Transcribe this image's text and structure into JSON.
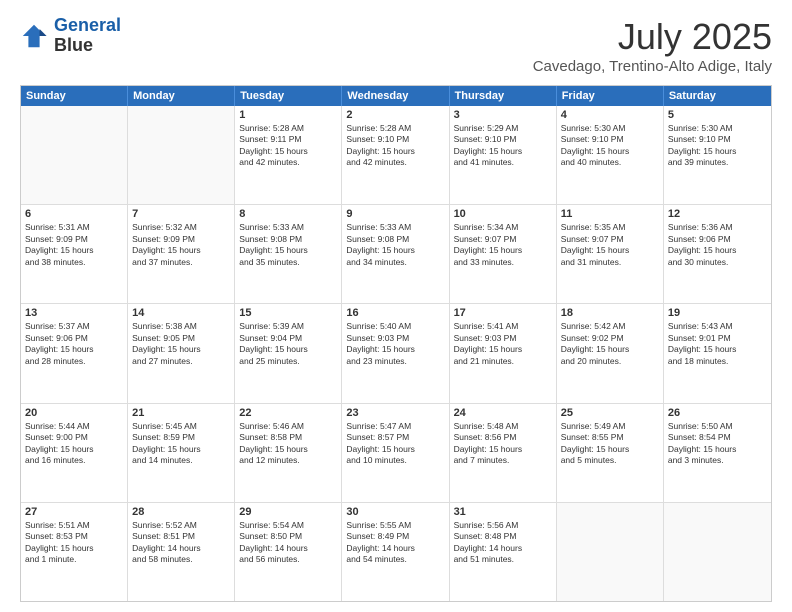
{
  "header": {
    "logo_line1": "General",
    "logo_line2": "Blue",
    "month": "July 2025",
    "location": "Cavedago, Trentino-Alto Adige, Italy"
  },
  "weekdays": [
    "Sunday",
    "Monday",
    "Tuesday",
    "Wednesday",
    "Thursday",
    "Friday",
    "Saturday"
  ],
  "rows": [
    [
      {
        "day": "",
        "lines": []
      },
      {
        "day": "",
        "lines": []
      },
      {
        "day": "1",
        "lines": [
          "Sunrise: 5:28 AM",
          "Sunset: 9:11 PM",
          "Daylight: 15 hours",
          "and 42 minutes."
        ]
      },
      {
        "day": "2",
        "lines": [
          "Sunrise: 5:28 AM",
          "Sunset: 9:10 PM",
          "Daylight: 15 hours",
          "and 42 minutes."
        ]
      },
      {
        "day": "3",
        "lines": [
          "Sunrise: 5:29 AM",
          "Sunset: 9:10 PM",
          "Daylight: 15 hours",
          "and 41 minutes."
        ]
      },
      {
        "day": "4",
        "lines": [
          "Sunrise: 5:30 AM",
          "Sunset: 9:10 PM",
          "Daylight: 15 hours",
          "and 40 minutes."
        ]
      },
      {
        "day": "5",
        "lines": [
          "Sunrise: 5:30 AM",
          "Sunset: 9:10 PM",
          "Daylight: 15 hours",
          "and 39 minutes."
        ]
      }
    ],
    [
      {
        "day": "6",
        "lines": [
          "Sunrise: 5:31 AM",
          "Sunset: 9:09 PM",
          "Daylight: 15 hours",
          "and 38 minutes."
        ]
      },
      {
        "day": "7",
        "lines": [
          "Sunrise: 5:32 AM",
          "Sunset: 9:09 PM",
          "Daylight: 15 hours",
          "and 37 minutes."
        ]
      },
      {
        "day": "8",
        "lines": [
          "Sunrise: 5:33 AM",
          "Sunset: 9:08 PM",
          "Daylight: 15 hours",
          "and 35 minutes."
        ]
      },
      {
        "day": "9",
        "lines": [
          "Sunrise: 5:33 AM",
          "Sunset: 9:08 PM",
          "Daylight: 15 hours",
          "and 34 minutes."
        ]
      },
      {
        "day": "10",
        "lines": [
          "Sunrise: 5:34 AM",
          "Sunset: 9:07 PM",
          "Daylight: 15 hours",
          "and 33 minutes."
        ]
      },
      {
        "day": "11",
        "lines": [
          "Sunrise: 5:35 AM",
          "Sunset: 9:07 PM",
          "Daylight: 15 hours",
          "and 31 minutes."
        ]
      },
      {
        "day": "12",
        "lines": [
          "Sunrise: 5:36 AM",
          "Sunset: 9:06 PM",
          "Daylight: 15 hours",
          "and 30 minutes."
        ]
      }
    ],
    [
      {
        "day": "13",
        "lines": [
          "Sunrise: 5:37 AM",
          "Sunset: 9:06 PM",
          "Daylight: 15 hours",
          "and 28 minutes."
        ]
      },
      {
        "day": "14",
        "lines": [
          "Sunrise: 5:38 AM",
          "Sunset: 9:05 PM",
          "Daylight: 15 hours",
          "and 27 minutes."
        ]
      },
      {
        "day": "15",
        "lines": [
          "Sunrise: 5:39 AM",
          "Sunset: 9:04 PM",
          "Daylight: 15 hours",
          "and 25 minutes."
        ]
      },
      {
        "day": "16",
        "lines": [
          "Sunrise: 5:40 AM",
          "Sunset: 9:03 PM",
          "Daylight: 15 hours",
          "and 23 minutes."
        ]
      },
      {
        "day": "17",
        "lines": [
          "Sunrise: 5:41 AM",
          "Sunset: 9:03 PM",
          "Daylight: 15 hours",
          "and 21 minutes."
        ]
      },
      {
        "day": "18",
        "lines": [
          "Sunrise: 5:42 AM",
          "Sunset: 9:02 PM",
          "Daylight: 15 hours",
          "and 20 minutes."
        ]
      },
      {
        "day": "19",
        "lines": [
          "Sunrise: 5:43 AM",
          "Sunset: 9:01 PM",
          "Daylight: 15 hours",
          "and 18 minutes."
        ]
      }
    ],
    [
      {
        "day": "20",
        "lines": [
          "Sunrise: 5:44 AM",
          "Sunset: 9:00 PM",
          "Daylight: 15 hours",
          "and 16 minutes."
        ]
      },
      {
        "day": "21",
        "lines": [
          "Sunrise: 5:45 AM",
          "Sunset: 8:59 PM",
          "Daylight: 15 hours",
          "and 14 minutes."
        ]
      },
      {
        "day": "22",
        "lines": [
          "Sunrise: 5:46 AM",
          "Sunset: 8:58 PM",
          "Daylight: 15 hours",
          "and 12 minutes."
        ]
      },
      {
        "day": "23",
        "lines": [
          "Sunrise: 5:47 AM",
          "Sunset: 8:57 PM",
          "Daylight: 15 hours",
          "and 10 minutes."
        ]
      },
      {
        "day": "24",
        "lines": [
          "Sunrise: 5:48 AM",
          "Sunset: 8:56 PM",
          "Daylight: 15 hours",
          "and 7 minutes."
        ]
      },
      {
        "day": "25",
        "lines": [
          "Sunrise: 5:49 AM",
          "Sunset: 8:55 PM",
          "Daylight: 15 hours",
          "and 5 minutes."
        ]
      },
      {
        "day": "26",
        "lines": [
          "Sunrise: 5:50 AM",
          "Sunset: 8:54 PM",
          "Daylight: 15 hours",
          "and 3 minutes."
        ]
      }
    ],
    [
      {
        "day": "27",
        "lines": [
          "Sunrise: 5:51 AM",
          "Sunset: 8:53 PM",
          "Daylight: 15 hours",
          "and 1 minute."
        ]
      },
      {
        "day": "28",
        "lines": [
          "Sunrise: 5:52 AM",
          "Sunset: 8:51 PM",
          "Daylight: 14 hours",
          "and 58 minutes."
        ]
      },
      {
        "day": "29",
        "lines": [
          "Sunrise: 5:54 AM",
          "Sunset: 8:50 PM",
          "Daylight: 14 hours",
          "and 56 minutes."
        ]
      },
      {
        "day": "30",
        "lines": [
          "Sunrise: 5:55 AM",
          "Sunset: 8:49 PM",
          "Daylight: 14 hours",
          "and 54 minutes."
        ]
      },
      {
        "day": "31",
        "lines": [
          "Sunrise: 5:56 AM",
          "Sunset: 8:48 PM",
          "Daylight: 14 hours",
          "and 51 minutes."
        ]
      },
      {
        "day": "",
        "lines": []
      },
      {
        "day": "",
        "lines": []
      }
    ]
  ]
}
